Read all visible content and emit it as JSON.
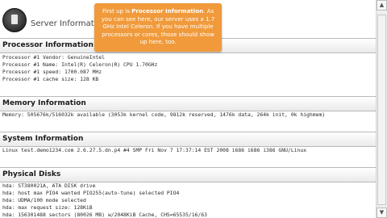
{
  "page": {
    "title": "Server Information"
  },
  "tooltip": {
    "lead": "First up is ",
    "emphasis": "Processor Information",
    "rest": ". As you can see here, our server uses a 1.7 GHz Intel Celeron. If you have multiple processors or cores, those should show up here, too."
  },
  "sections": [
    {
      "title": "Processor Information",
      "lines": [
        "Processor #1 Vendor: GenuineIntel",
        "Processor #1 Name: Intel(R) Celeron(R) CPU 1.70GHz",
        "Processor #1 speed: 1700.087 MHz",
        "Processor #1 cache size: 128 KB"
      ]
    },
    {
      "title": "Memory Information",
      "lines": [
        "Memory: 505676k/516032k available (3053k kernel code, 9812k reserved, 1476k data, 264k init, 0k highmem)"
      ]
    },
    {
      "title": "System Information",
      "lines": [
        "Linux test.demo1234.com 2.6.27.5.dn.p4 #4 SMP Fri Nov 7 17:37:14 EST 2008 i686 i686 i386 GNU/Linux"
      ]
    },
    {
      "title": "Physical Disks",
      "lines": [
        "hda: ST380021A, ATA DISK drive",
        "hda: host max PIO4 wanted PIO255(auto-tune) selected PIO4",
        "hda: UDMA/100 mode selected",
        "hda: max request size: 128KiB",
        "hda: 156301488 sectors (80026 MB) w/2048KiB Cache, CHS=65535/16/63"
      ]
    }
  ],
  "scrollbar": {
    "up_glyph": "▲",
    "down_glyph": "▼",
    "position": 0.05
  }
}
